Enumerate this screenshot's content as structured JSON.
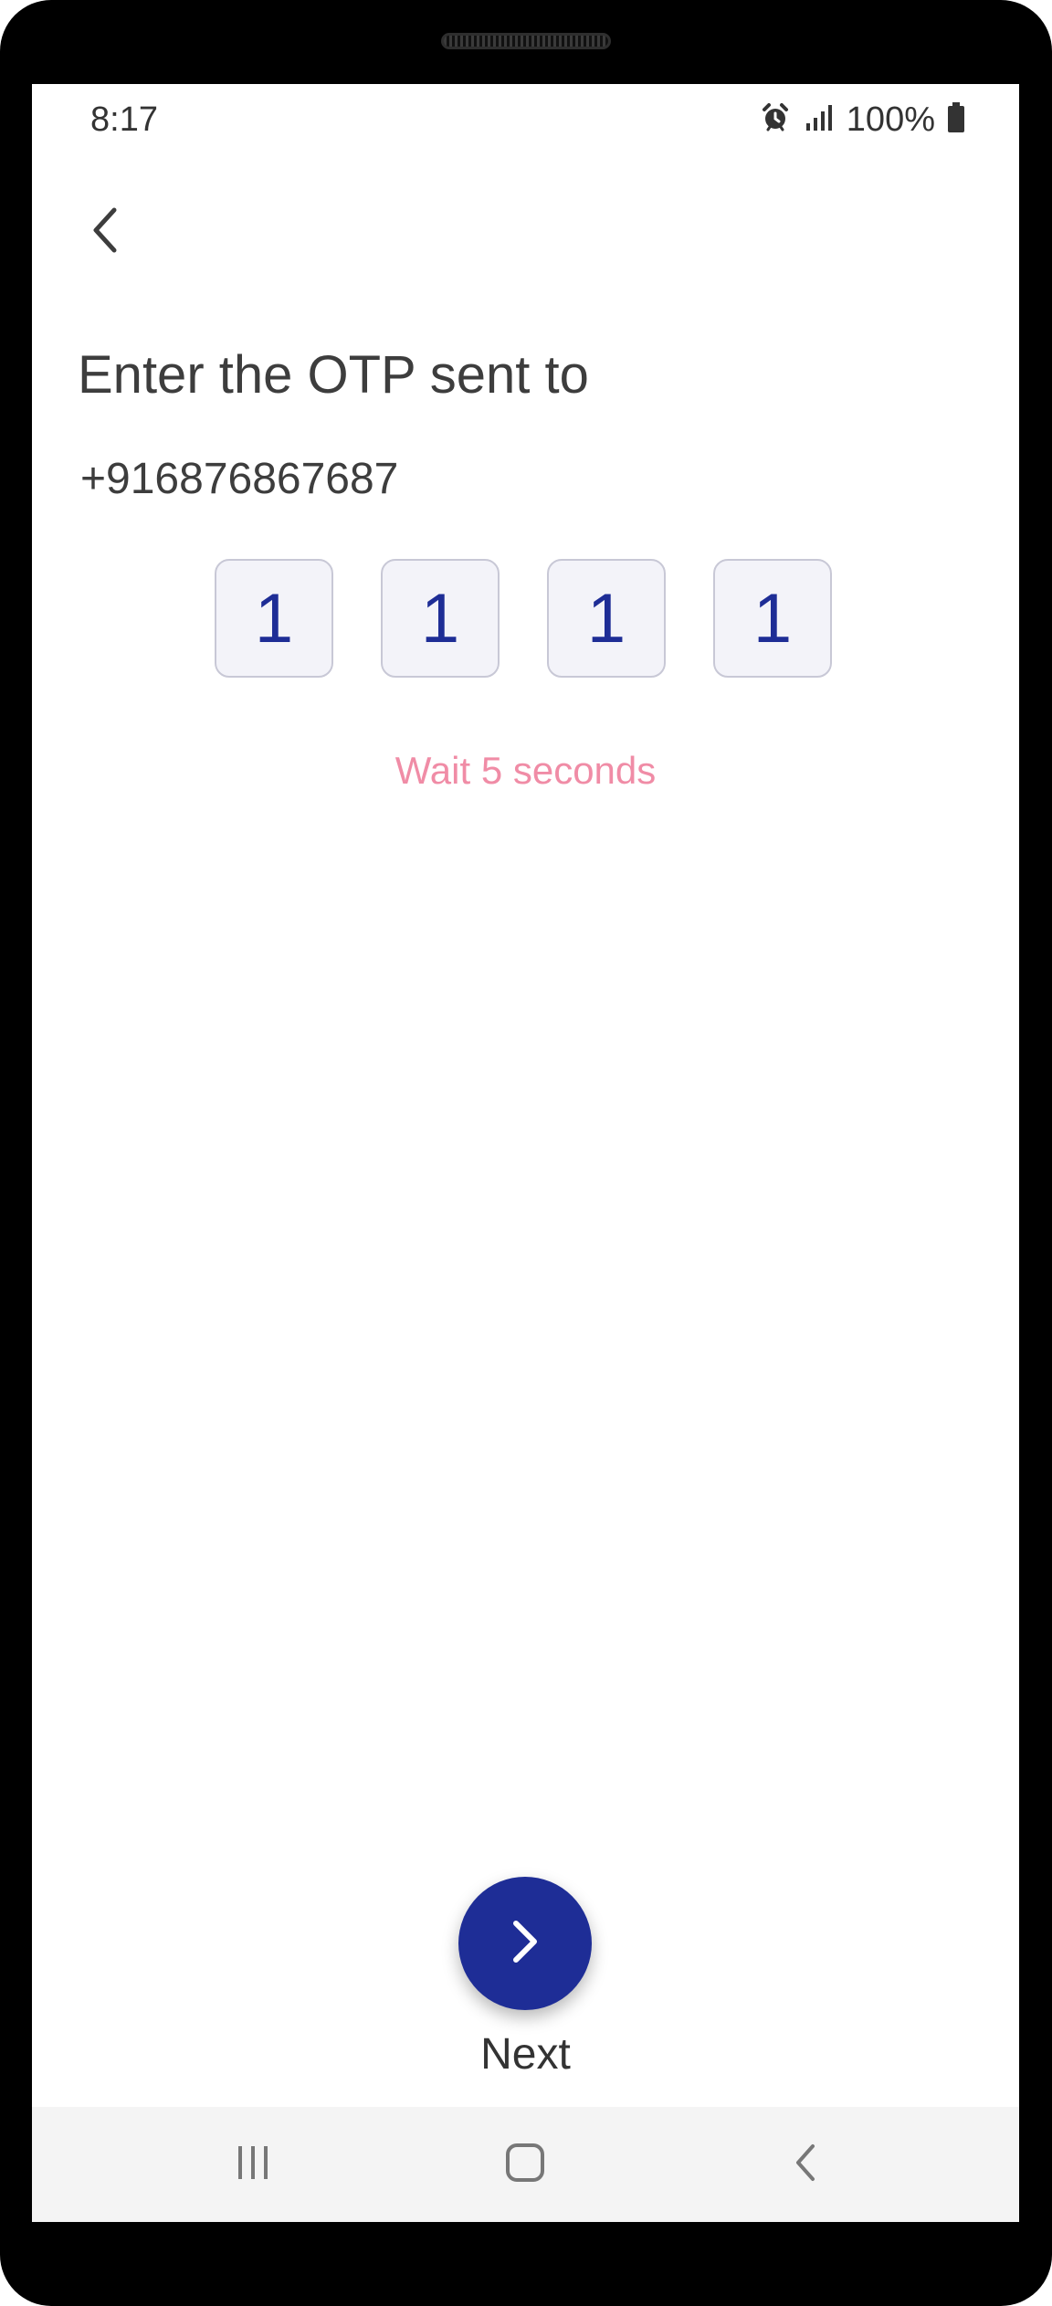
{
  "status_bar": {
    "time": "8:17",
    "battery_percent": "100%",
    "icons": [
      "alarm-icon",
      "signal-icon",
      "battery-icon"
    ]
  },
  "header": {
    "back_icon": "chevron-left-icon"
  },
  "main": {
    "title": "Enter the OTP sent to",
    "phone_number": "+916876867687",
    "otp_digits": [
      "1",
      "1",
      "1",
      "1"
    ],
    "resend_status": "Wait 5 seconds"
  },
  "footer": {
    "next_icon": "chevron-right-icon",
    "next_label": "Next"
  },
  "nav_bar": {
    "items": [
      "recents-icon",
      "home-icon",
      "back-icon"
    ]
  },
  "colors": {
    "accent": "#1e2d96",
    "wait_text": "#f08ca6",
    "otp_box_bg": "#f3f3f9",
    "nav_bg": "#f4f4f4"
  }
}
